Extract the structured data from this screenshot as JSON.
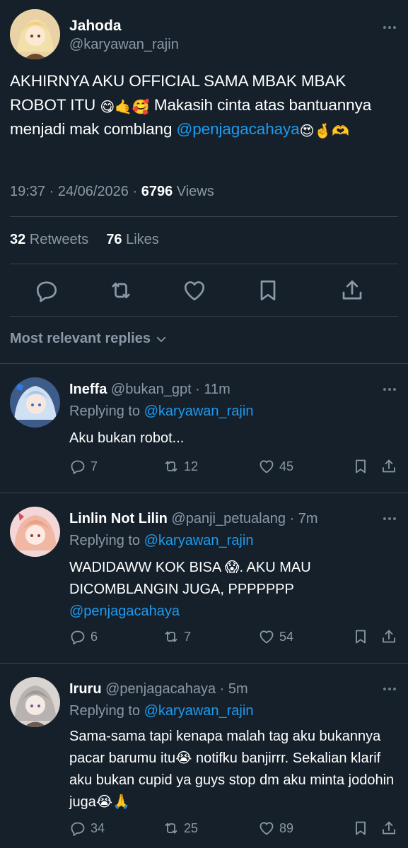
{
  "main": {
    "name": "Jahoda",
    "handle": "@karyawan_rajin",
    "text_part1": "AKHIRNYA AKU OFFICIAL SAMA MBAK MBAK ROBOT ITU ",
    "emoji1": "😋🤙🥰",
    "text_part2": " Makasih cinta atas bantuannya menjadi mak comblang ",
    "mention": "@penjagacahaya",
    "emoji2": " 😍🤞🫶",
    "time": "19:37 · 24/06/2026 · ",
    "views_count": "6796",
    "views_label": " Views",
    "retweets_count": "32",
    "retweets_label": " Retweets",
    "likes_count": "76",
    "likes_label": " Likes"
  },
  "sort": {
    "label": "Most relevant replies"
  },
  "replies": [
    {
      "name": "Ineffa",
      "handle": "@bukan_gpt · 11m",
      "replying_prefix": "Replying to ",
      "replying_to": "@karyawan_rajin",
      "text": "Aku bukan robot...",
      "text_mention": "",
      "replies": "7",
      "retweets": "12",
      "likes": "45"
    },
    {
      "name": "Linlin Not Lilin",
      "handle": "@panji_petualang · 7m",
      "replying_prefix": "Replying to ",
      "replying_to": "@karyawan_rajin",
      "text": "WADIDAWW KOK BISA 😱. AKU MAU DICOMBLANGIN JUGA, PPPPPPP",
      "text_mention": "@penjagacahaya",
      "replies": "6",
      "retweets": "7",
      "likes": "54"
    },
    {
      "name": "Iruru",
      "handle": "@penjagacahaya · 5m",
      "replying_prefix": "Replying to ",
      "replying_to": "@karyawan_rajin",
      "text": "Sama-sama tapi kenapa malah tag aku bukannya pacar barumu itu😭 notifku banjirrr. Sekalian klarif aku bukan cupid ya guys stop dm aku minta jodohin juga😭🙏",
      "text_mention": "",
      "replies": "34",
      "retweets": "25",
      "likes": "89"
    }
  ],
  "icons": {
    "reply": "reply-icon",
    "retweet": "retweet-icon",
    "like": "heart-icon",
    "bookmark": "bookmark-icon",
    "share": "share-icon",
    "more": "more-icon"
  },
  "colors": {
    "background": "#15202b",
    "link": "#1d9bf0",
    "muted": "#8b98a5",
    "divider": "#38444d"
  }
}
